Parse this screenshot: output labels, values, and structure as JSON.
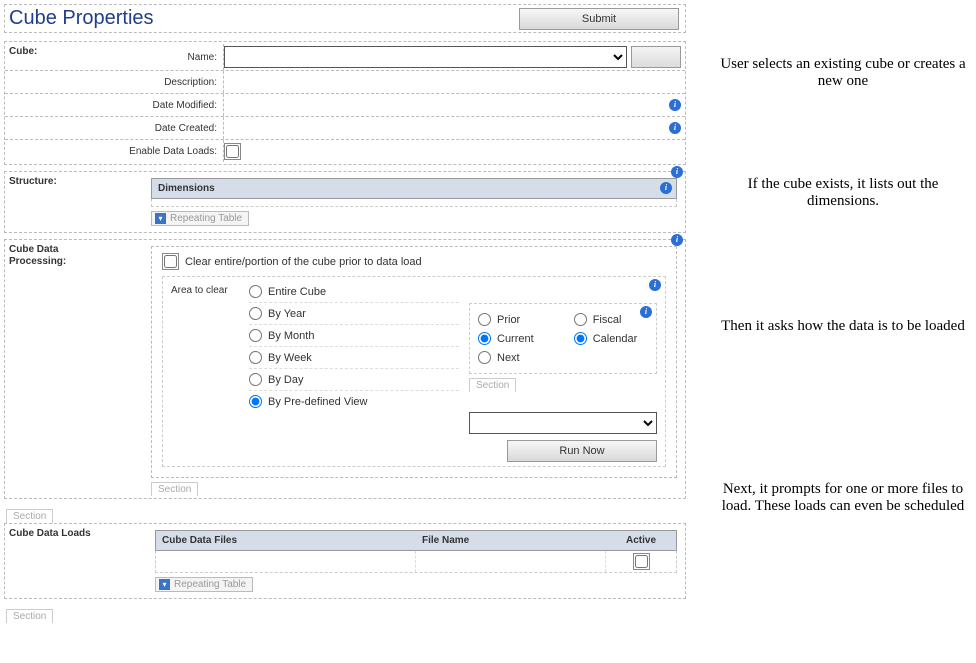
{
  "title": "Cube Properties",
  "submit_label": "Submit",
  "cube": {
    "section_label": "Cube:",
    "name_label": "Name:",
    "name_value": "",
    "new_button_label": "",
    "description_label": "Description:",
    "description_value": "",
    "date_modified_label": "Date Modified:",
    "date_modified_value": "",
    "date_created_label": "Date Created:",
    "date_created_value": "",
    "enable_loads_label": "Enable Data Loads:",
    "enable_loads_checked": false
  },
  "structure": {
    "section_label": "Structure:",
    "dimensions_header": "Dimensions",
    "repeating_table_label": "Repeating Table"
  },
  "processing": {
    "section_label": "Cube Data Processing:",
    "clear_checkbox_label": "Clear entire/portion of the cube prior to data load",
    "clear_checked": false,
    "area_label": "Area to clear",
    "area_options": [
      {
        "key": "entire",
        "label": "Entire Cube",
        "selected": false
      },
      {
        "key": "year",
        "label": "By Year",
        "selected": false
      },
      {
        "key": "month",
        "label": "By Month",
        "selected": false
      },
      {
        "key": "week",
        "label": "By Week",
        "selected": false
      },
      {
        "key": "day",
        "label": "By Day",
        "selected": false
      },
      {
        "key": "view",
        "label": "By Pre-defined View",
        "selected": true
      }
    ],
    "timeframe_options": [
      {
        "key": "prior",
        "label": "Prior",
        "selected": false
      },
      {
        "key": "current",
        "label": "Current",
        "selected": true
      },
      {
        "key": "next",
        "label": "Next",
        "selected": false
      }
    ],
    "calendar_options": [
      {
        "key": "fiscal",
        "label": "Fiscal",
        "selected": false
      },
      {
        "key": "calendar",
        "label": "Calendar",
        "selected": true
      }
    ],
    "section_tab_label": "Section",
    "view_select_value": "",
    "run_now_label": "Run Now"
  },
  "section_tab_label": "Section",
  "loads": {
    "section_label": "Cube Data Loads",
    "col_files": "Cube Data Files",
    "col_filename": "File Name",
    "col_active": "Active",
    "row_active_checked": false,
    "repeating_table_label": "Repeating Table"
  },
  "notes": {
    "n1": "User selects an existing cube or creates a new one",
    "n2": "If the cube exists, it lists out the dimensions.",
    "n3": "Then it asks how the data is to be loaded",
    "n4": "Next, it prompts for one or more files to load. These loads can even be scheduled"
  },
  "info_icon_glyph": "i"
}
